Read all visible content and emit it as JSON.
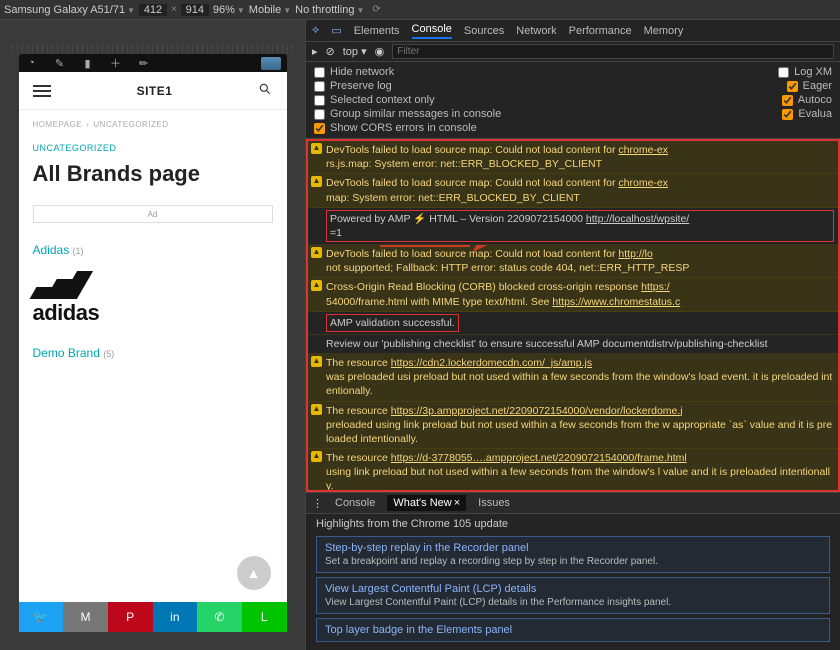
{
  "toolbar": {
    "device": "Samsung Galaxy A51/71",
    "width": "412",
    "height": "914",
    "zoom": "96%",
    "mode": "Mobile",
    "throttle": "No throttling"
  },
  "devtools": {
    "tabs": [
      "Elements",
      "Console",
      "Sources",
      "Network",
      "Performance",
      "Memory"
    ],
    "active_tab": "Console",
    "console_toolbar": {
      "context": "top",
      "filter_placeholder": "Filter"
    },
    "options": {
      "left": [
        {
          "label": "Hide network",
          "checked": false
        },
        {
          "label": "Preserve log",
          "checked": false
        },
        {
          "label": "Selected context only",
          "checked": false
        },
        {
          "label": "Group similar messages in console",
          "checked": false
        },
        {
          "label": "Show CORS errors in console",
          "checked": true
        }
      ],
      "right": [
        {
          "label": "Log XM",
          "checked": false
        },
        {
          "label": "Eager",
          "checked": true
        },
        {
          "label": "Autoco",
          "checked": true
        },
        {
          "label": "Evalua",
          "checked": true
        }
      ]
    },
    "messages": [
      {
        "type": "warn",
        "text": "DevTools failed to load source map: Could not load content for ",
        "link": "chrome-ex",
        "text2": "rs.js.map: System error: net::ERR_BLOCKED_BY_CLIENT"
      },
      {
        "type": "warn",
        "text": "DevTools failed to load source map: Could not load content for ",
        "link": "chrome-ex",
        "text2": "map: System error: net::ERR_BLOCKED_BY_CLIENT"
      },
      {
        "type": "info",
        "boxed": true,
        "text": "Powered by AMP ⚡ HTML – Version 2209072154000 ",
        "link": "http://localhost/wpsite/",
        "text2": "=1"
      },
      {
        "type": "warn",
        "text": "DevTools failed to load source map: Could not load content for ",
        "link": "http://lo",
        "text2": "not supported; Fallback: HTTP error: status code 404, net::ERR_HTTP_RESP"
      },
      {
        "type": "warn",
        "text": "Cross-Origin Read Blocking (CORB) blocked cross-origin response ",
        "link": "https:/",
        "text2": "54000/frame.html with MIME type text/html. See ",
        "link2": "https://www.chromestatus.c"
      },
      {
        "type": "info",
        "boxed": true,
        "short": true,
        "text": "AMP validation successful."
      },
      {
        "type": "info",
        "text": "Review our 'publishing checklist' to ensure successful AMP documentdistr",
        "text2": "v/publishing-checklist"
      },
      {
        "type": "warn",
        "text": "The resource ",
        "link": "https://cdn2.lockerdomecdn.com/_js/amp.js",
        "text2": " was preloaded usi preload but not used within a few seconds from the window's load event. it is preloaded intentionally."
      },
      {
        "type": "warn",
        "text": "The resource ",
        "link": "https://3p.ampproject.net/2209072154000/vendor/lockerdome.j",
        "text2": " preloaded using link preload but not used within a few seconds from the w appropriate `as` value and it is preloaded intentionally."
      },
      {
        "type": "warn",
        "text": "The resource ",
        "link": "https://d-3778055….ampproject.net/2209072154000/frame.html",
        "text2": " using link preload but not used within a few seconds from the window's l value and it is preloaded intentionally."
      }
    ],
    "bottom_tabs": {
      "items": [
        "Console",
        "What's New",
        "Issues"
      ],
      "active": "What's New"
    },
    "whatsnew": {
      "heading": "Highlights from the Chrome 105 update",
      "cards": [
        {
          "t": "Step-by-step replay in the Recorder panel",
          "d": "Set a breakpoint and replay a recording step by step in the Recorder panel."
        },
        {
          "t": "View Largest Contentful Paint (LCP) details",
          "d": "View Largest Contentful Paint (LCP) details in the Performance insights panel."
        },
        {
          "t": "Top layer badge in the Elements panel",
          "d": ""
        }
      ]
    }
  },
  "site": {
    "title": "SITE1",
    "breadcrumb": {
      "a": "HOMEPAGE",
      "b": "UNCATEGORIZED"
    },
    "category": "UNCATEGORIZED",
    "h1": "All Brands page",
    "ad": "Ad",
    "brands": [
      {
        "name": "Adidas",
        "count": "(1)"
      },
      {
        "name": "Demo Brand",
        "count": "(5)"
      }
    ]
  }
}
